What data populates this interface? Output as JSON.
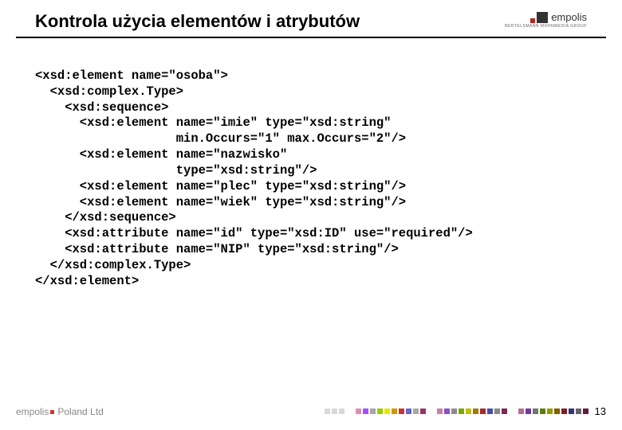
{
  "header": {
    "title": "Kontrola użycia elementów i atrybutów",
    "brand": "empolis",
    "brand_sub": "BERTELSMANN MOHNMEDIA GROUP"
  },
  "code": {
    "l1": "<xsd:element name=\"osoba\">",
    "l2": "  <xsd:complex.Type>",
    "l3": "    <xsd:sequence>",
    "l4": "      <xsd:element name=\"imie\" type=\"xsd:string\"",
    "l5": "                   min.Occurs=\"1\" max.Occurs=\"2\"/>",
    "l6": "      <xsd:element name=\"nazwisko\"",
    "l7": "                   type=\"xsd:string\"/>",
    "l8": "      <xsd:element name=\"plec\" type=\"xsd:string\"/>",
    "l9": "      <xsd:element name=\"wiek\" type=\"xsd:string\"/>",
    "l10": "    </xsd:sequence>",
    "l11": "    <xsd:attribute name=\"id\" type=\"xsd:ID\" use=\"required\"/>",
    "l12": "    <xsd:attribute name=\"NIP\" type=\"xsd:string\"/>",
    "l13": "  </xsd:complex.Type>",
    "l14": "</xsd:element>"
  },
  "footer": {
    "brand": "empolis",
    "sub": "Poland Ltd",
    "page": "13",
    "colors": [
      "#d9d9d9",
      "#d9d9d9",
      "#d9d9d9",
      "gap",
      "#d98fb3",
      "#a64dff",
      "#a6a6a6",
      "#99cc00",
      "#e6e600",
      "#cc9900",
      "#cc3333",
      "#6666cc",
      "#aaaaaa",
      "#993366",
      "gap",
      "#c97fa8",
      "#8f4dbf",
      "#8c8c8c",
      "#7aa600",
      "#bfbf00",
      "#a67a00",
      "#a62929",
      "#4d4da6",
      "#888888",
      "#7a2952",
      "gap",
      "#b36f96",
      "#733999",
      "#737373",
      "#5c8000",
      "#999900",
      "#806000",
      "#802020",
      "#333380",
      "#666666",
      "#5c1f3d"
    ]
  }
}
